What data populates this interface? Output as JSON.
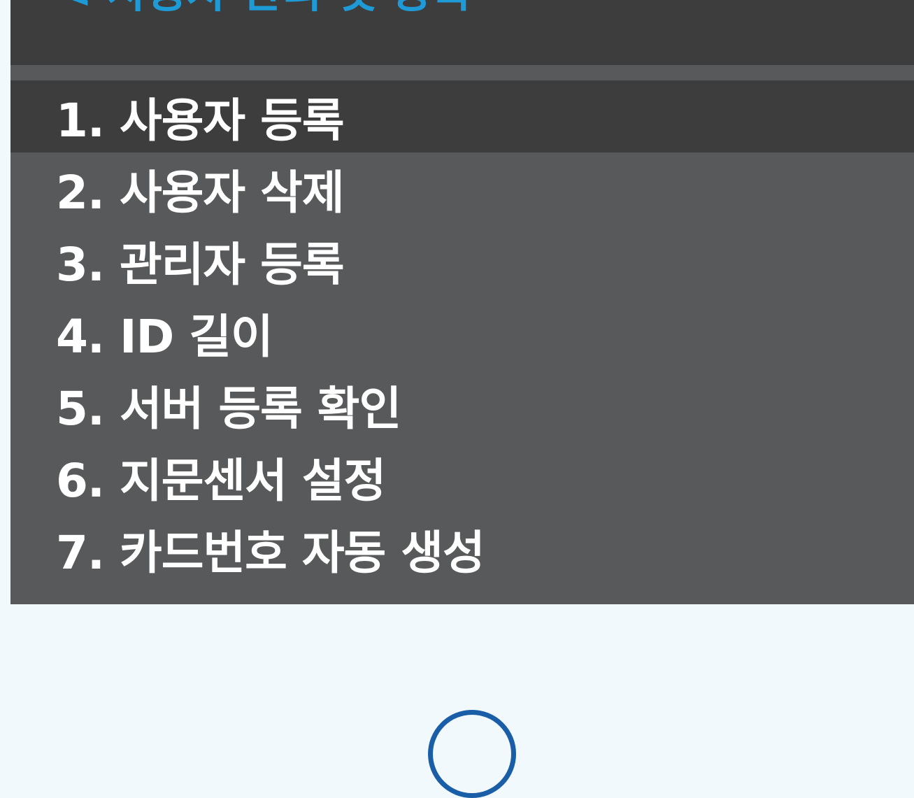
{
  "header": {
    "title": "< 사용자 관리 및 등록",
    "title_color": "#1e9bd7"
  },
  "menu": {
    "selected_index": 0,
    "items": [
      {
        "label": "1. 사용자 등록"
      },
      {
        "label": "2. 사용자 삭제"
      },
      {
        "label": "3. 관리자 등록"
      },
      {
        "label": "4. ID 길이"
      },
      {
        "label": "5. 서버 등록 확인"
      },
      {
        "label": "6. 지문센서 설정"
      },
      {
        "label": "7. 카드번호 자동 생성"
      }
    ]
  },
  "colors": {
    "screen_background": "#58595b",
    "header_background": "#3d3d3d",
    "selected_item_background": "#3d3d3d",
    "device_background": "#f2f9fc",
    "home_button_ring": "#1a5ea8"
  }
}
